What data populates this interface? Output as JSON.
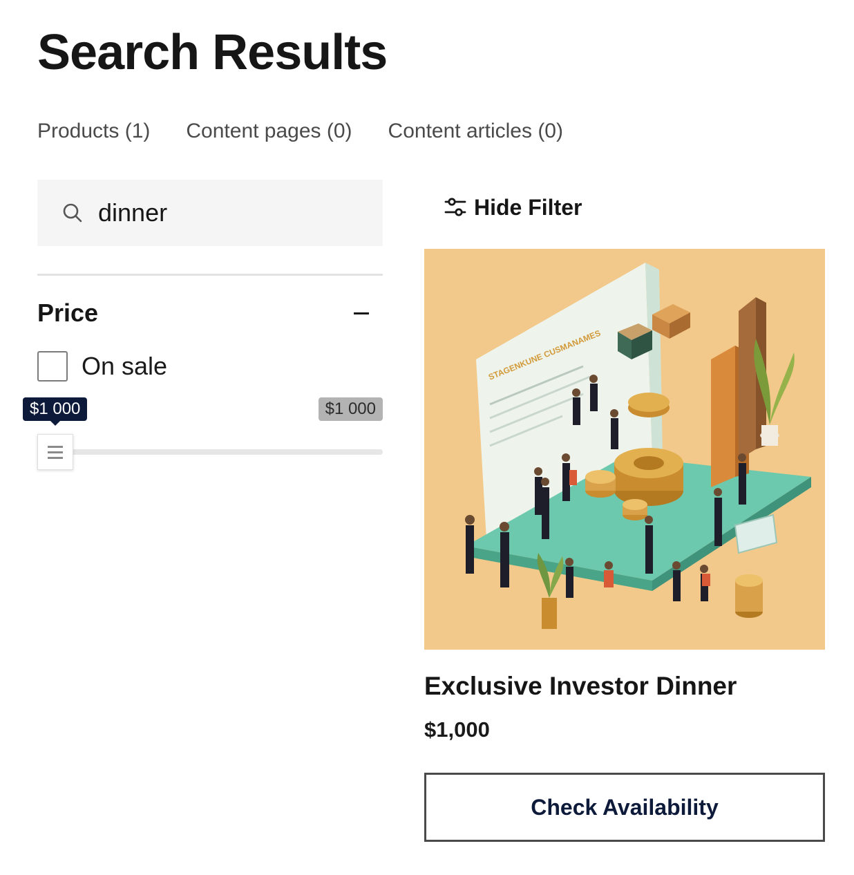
{
  "page": {
    "title": "Search Results"
  },
  "tabs": [
    {
      "label": "Products (1)"
    },
    {
      "label": "Content pages (0)"
    },
    {
      "label": "Content articles (0)"
    }
  ],
  "search": {
    "value": "dinner",
    "icon": "search-icon"
  },
  "filters": {
    "price": {
      "title": "Price",
      "collapse_icon": "minus-icon",
      "on_sale_label": "On sale",
      "on_sale_checked": false,
      "range": {
        "min_label": "$1 000",
        "max_label": "$1 000",
        "min_value": 1000,
        "max_value": 1000
      }
    },
    "hide_filter_label": "Hide Filter",
    "hide_filter_icon": "sliders-icon"
  },
  "products": [
    {
      "name": "Exclusive Investor Dinner",
      "price": "$1,000",
      "cta": "Check Availability",
      "image_art_text": "STAGENKUNE CUSMANAMES"
    }
  ],
  "colors": {
    "tooltip_active": "#0d1a3a",
    "tooltip_inactive": "#b3b3b3",
    "image_bg": "#f2c98a",
    "teal": "#6dc9ad",
    "gold": "#d9a24a"
  }
}
